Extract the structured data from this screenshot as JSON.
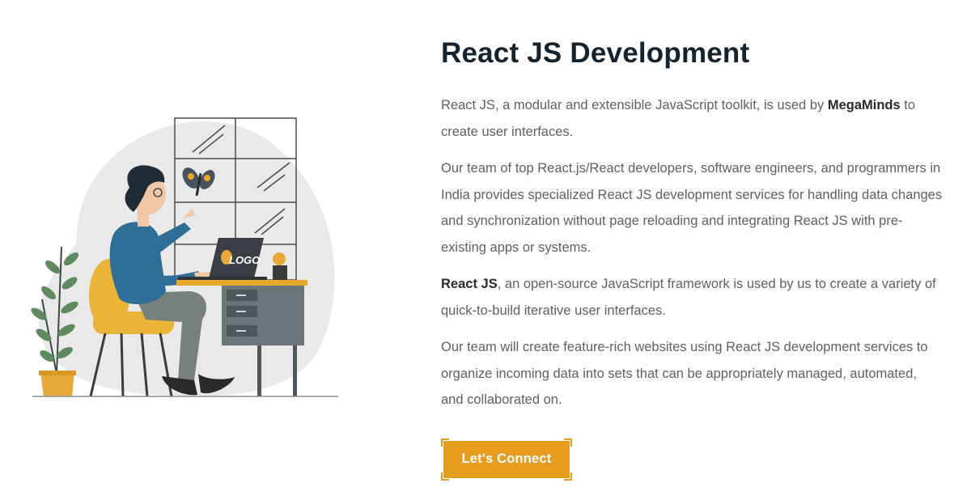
{
  "illustration": {
    "logo_text": "LOGO"
  },
  "section": {
    "title": "React JS Development",
    "paragraphs": [
      {
        "before": "React JS, a modular and extensible JavaScript toolkit, is used by ",
        "strong": "MegaMinds",
        "after": " to create user interfaces."
      },
      {
        "text": "Our team of top React.js/React developers, software engineers, and programmers in India provides specialized React JS development services for handling data changes and synchronization without page reloading and integrating React JS with pre-existing apps or systems."
      },
      {
        "strong": "React JS",
        "after": ", an open-source JavaScript framework is used by us to create a variety of quick-to-build iterative user interfaces."
      },
      {
        "text": "Our team will create feature-rich websites using React JS development services to organize incoming data into sets that can be appropriately managed, automated, and collaborated on."
      }
    ],
    "cta_label": "Let's Connect"
  },
  "colors": {
    "accent": "#e69c1e",
    "heading": "#132430",
    "body_text": "#5d6064"
  }
}
